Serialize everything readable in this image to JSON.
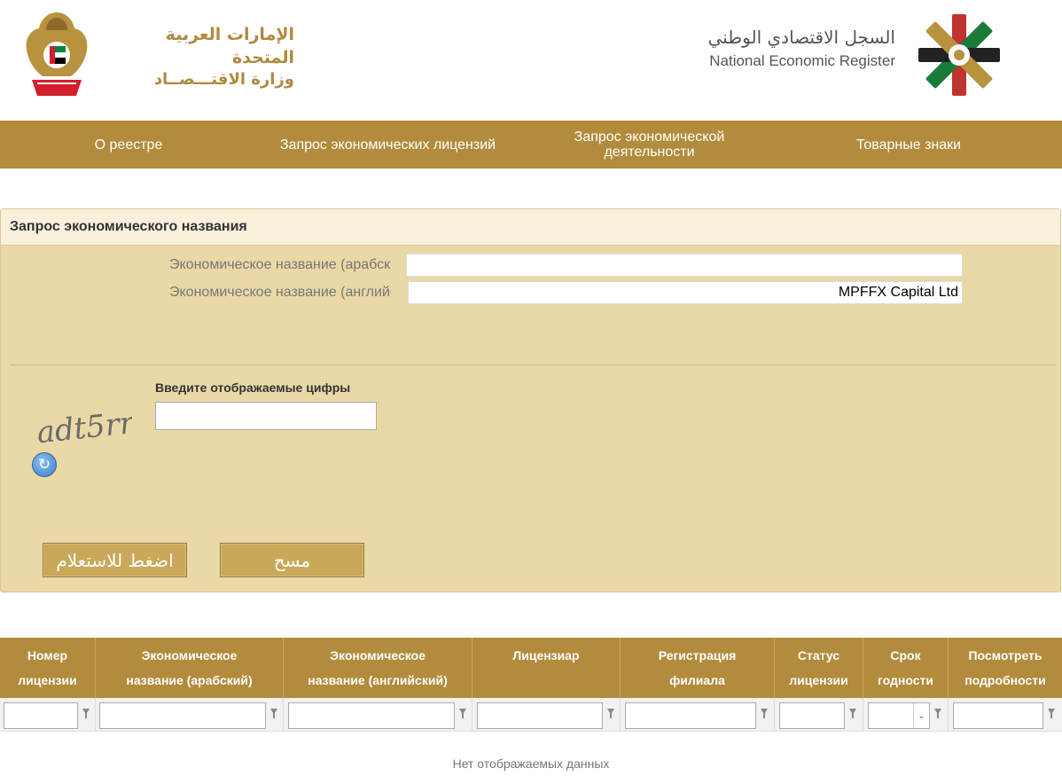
{
  "header": {
    "uae_title_line1": "الإمارات العربية المتحدة",
    "uae_title_line2": "وزارة الاقتـــصــاد",
    "register_title_ar": "السجل الاقتصادي الوطني",
    "register_title_en": "National Economic Register"
  },
  "nav": {
    "items": [
      {
        "label": "О реестре"
      },
      {
        "label": "Запрос экономических лицензий"
      },
      {
        "label": "Запрос экономической деятельности"
      },
      {
        "label": "Товарные знаки"
      }
    ]
  },
  "search": {
    "title": "Запрос экономического названия",
    "arabic_name_label": "Экономическое название (арабский)",
    "arabic_name_value": "",
    "english_name_label": "Экономическое название (английский)",
    "english_name_value": "MPFFX Capital Ltd",
    "captcha_text": "adt5rr",
    "captcha_label": "Введите отображаемые цифры",
    "captcha_value": "",
    "submit_label": "اضغط للاستعلام",
    "clear_label": "مسح"
  },
  "grid": {
    "columns": [
      {
        "line1": "Номер",
        "line2": "лицензии"
      },
      {
        "line1": "Экономическое",
        "line2": "название (арабский)"
      },
      {
        "line1": "Экономическое",
        "line2": "название (английский)"
      },
      {
        "line1": "Лицензиар",
        "line2": ""
      },
      {
        "line1": "Регистрация",
        "line2": "филиала"
      },
      {
        "line1": "Статус",
        "line2": "лицензии"
      },
      {
        "line1": "Срок",
        "line2": "годности"
      },
      {
        "line1": "Посмотреть",
        "line2": "подробности"
      }
    ],
    "empty_message": "Нет отображаемых данных"
  },
  "colors": {
    "brand_gold": "#b28b3d",
    "panel_bg": "#ead8a6",
    "panel_header_bg": "#faf1dc",
    "button_bg": "#c9a959"
  }
}
